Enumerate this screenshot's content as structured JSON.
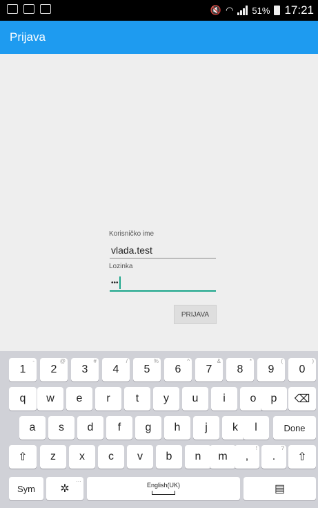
{
  "status_bar": {
    "battery": "51%",
    "time": "17:21"
  },
  "app_bar": {
    "title": "Prijava"
  },
  "form": {
    "username_label": "Korisničko ime",
    "username_value": "vlada.test",
    "password_label": "Lozinka",
    "password_value": "•••",
    "submit_label": "PRIJAVA"
  },
  "keyboard": {
    "row1": [
      {
        "k": "1",
        "s": "-"
      },
      {
        "k": "2",
        "s": "@"
      },
      {
        "k": "3",
        "s": "#"
      },
      {
        "k": "4",
        "s": "/"
      },
      {
        "k": "5",
        "s": "%"
      },
      {
        "k": "6",
        "s": "^"
      },
      {
        "k": "7",
        "s": "&"
      },
      {
        "k": "8",
        "s": "*"
      },
      {
        "k": "9",
        "s": "("
      },
      {
        "k": "0",
        "s": ")"
      }
    ],
    "row2": [
      "q",
      "w",
      "e",
      "r",
      "t",
      "y",
      "u",
      "i",
      "o",
      "p"
    ],
    "backspace": "⌫",
    "row3": [
      "a",
      "s",
      "d",
      "f",
      "g",
      "h",
      "j",
      "k",
      "l"
    ],
    "done": "Done",
    "shift": "⇧",
    "row4": [
      {
        "k": "z",
        "s": ""
      },
      {
        "k": "x",
        "s": ""
      },
      {
        "k": "c",
        "s": ""
      },
      {
        "k": "v",
        "s": ""
      },
      {
        "k": "b",
        "s": ""
      },
      {
        "k": "n",
        "s": ""
      },
      {
        "k": "m",
        "s": ""
      },
      {
        "k": ",",
        "s": "!"
      },
      {
        "k": ".",
        "s": "?"
      }
    ],
    "sym": "Sym",
    "settings": "✲",
    "settings_sup": "…",
    "space_label": "English(UK)",
    "clipboard": "▤"
  }
}
